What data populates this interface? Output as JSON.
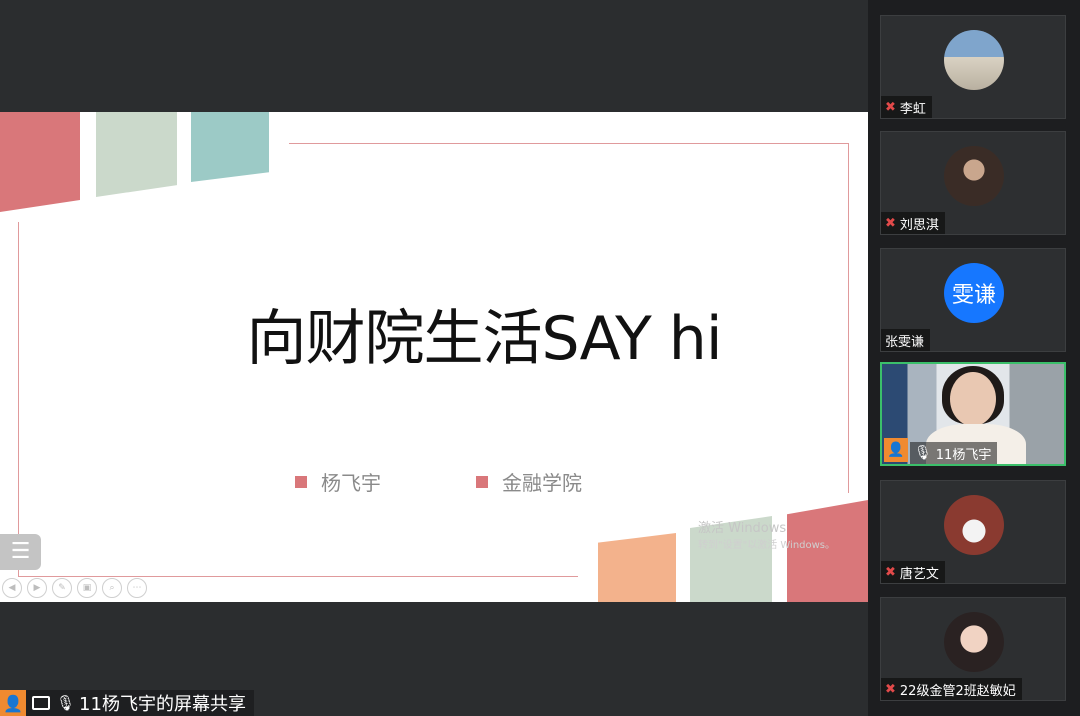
{
  "slide": {
    "title": "向财院生活SAY hi",
    "author_name": "杨飞宇",
    "author_school": "金融学院",
    "watermark_line1": "激活 Windows",
    "watermark_line2": "转到\"设置\"以激活 Windows。"
  },
  "share_bar": {
    "label": "11杨飞宇的屏幕共享"
  },
  "participants": [
    {
      "name": "李虹",
      "muted": true
    },
    {
      "name": "刘思淇",
      "muted": true
    },
    {
      "name": "张雯谦",
      "muted": false,
      "avatar_text": "雯谦"
    },
    {
      "name": "11杨飞宇",
      "muted": false,
      "speaking": true
    },
    {
      "name": "唐艺文",
      "muted": true
    },
    {
      "name": "22级金管2班赵敏妃",
      "muted": true
    }
  ],
  "colors": {
    "accent_red": "#d9777a",
    "accent_mint": "#cbd9cb",
    "accent_teal": "#9ccac6",
    "accent_orange": "#f3b28c",
    "active_border": "#3bbf6a",
    "avatar_blue": "#1677ff"
  },
  "icons": {
    "muted_mic": "microphone-muted-icon",
    "mic": "microphone-icon",
    "screen": "screen-share-icon",
    "person": "person-icon",
    "menu": "menu-list-icon"
  }
}
